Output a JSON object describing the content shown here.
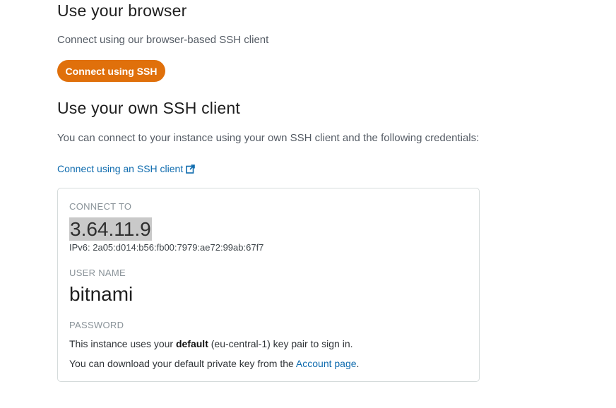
{
  "browser_section": {
    "heading": "Use your browser",
    "description": "Connect using our browser-based SSH client",
    "connect_button_label": "Connect using SSH",
    "button_color": "#e0700b"
  },
  "own_client_section": {
    "heading": "Use your own SSH client",
    "description": "You can connect to your instance using your own SSH client and the following credentials:",
    "link_label": "Connect using an SSH client",
    "link_icon": "external-link-icon",
    "link_color": "#0e6bae"
  },
  "credentials": {
    "connect_to_label": "CONNECT TO",
    "ip_address": "3.64.11.9",
    "ipv6": "IPv6: 2a05:d014:b56:fb00:7979:ae72:99ab:67f7",
    "user_name_label": "USER NAME",
    "user_name": "bitnami",
    "password_label": "PASSWORD",
    "password_text_prefix": "This instance uses your ",
    "password_text_bold": "default",
    "password_text_suffix": " (eu-central-1) key pair to sign in.",
    "download_text_prefix": "You can download your default private key from the ",
    "download_link_label": "Account page",
    "download_text_suffix": "."
  }
}
